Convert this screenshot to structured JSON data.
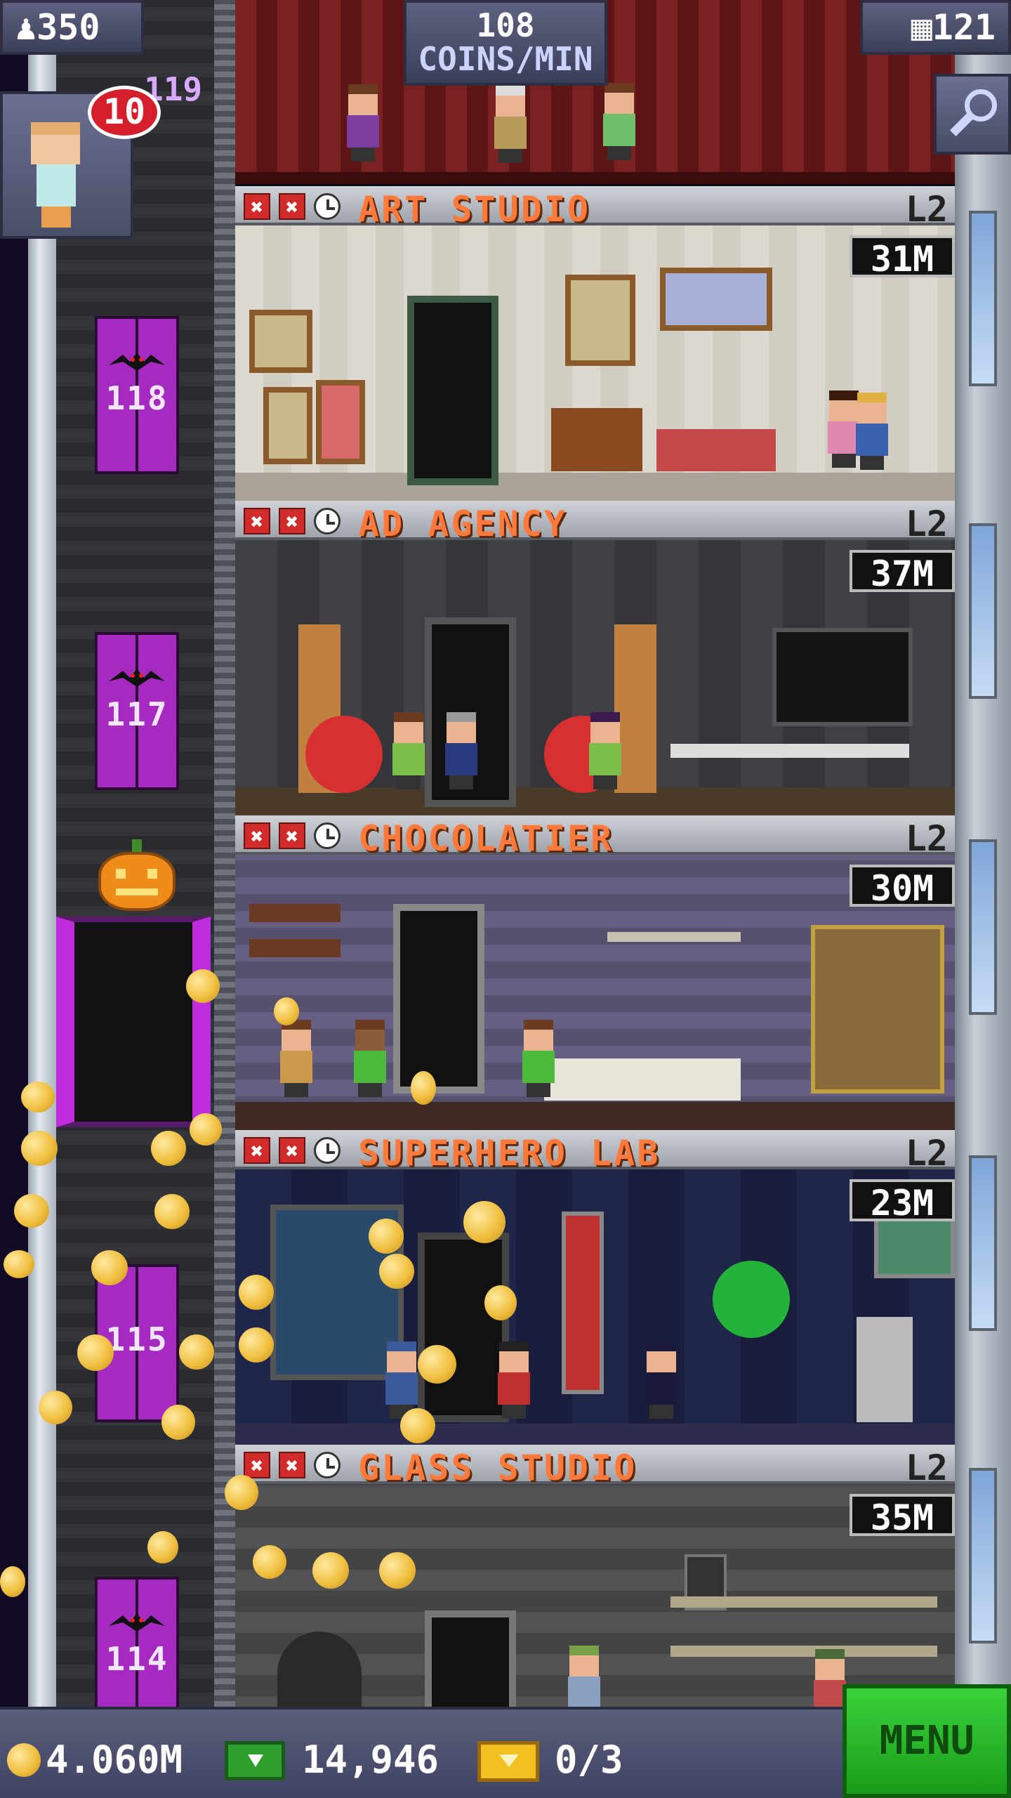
{
  "header": {
    "population": "350",
    "coins_rate_value": "108",
    "coins_rate_unit": "COINS/MIN",
    "floor_count": "121"
  },
  "visitor": {
    "badge": "10",
    "floor_hint": "119"
  },
  "elevator": {
    "floor_numbers": [
      "118",
      "117",
      "115",
      "114"
    ]
  },
  "floors": [
    {
      "name": "ART STUDIO",
      "level": "L2",
      "timer": "31M"
    },
    {
      "name": "AD AGENCY",
      "level": "L2",
      "timer": "37M"
    },
    {
      "name": "CHOCOLATIER",
      "level": "L2",
      "timer": "30M"
    },
    {
      "name": "SUPERHERO LAB",
      "level": "L2",
      "timer": "23M"
    },
    {
      "name": "GLASS STUDIO",
      "level": "L2",
      "timer": "35M"
    }
  ],
  "footer": {
    "coins": "4.060M",
    "bux": "14,946",
    "tickets": "0/3",
    "menu_label": "MENU"
  },
  "colors": {
    "floor_name": "#ff7a3a",
    "elevator_door": "#a52bc0",
    "menu_button": "#2ec42e",
    "badge": "#d61f2c"
  },
  "icons": [
    "population-icon",
    "floors-icon",
    "search-icon",
    "coin-icon",
    "bux-icon",
    "ticket-icon",
    "close-icon",
    "clock-icon",
    "bat-icon",
    "pumpkin-icon"
  ]
}
